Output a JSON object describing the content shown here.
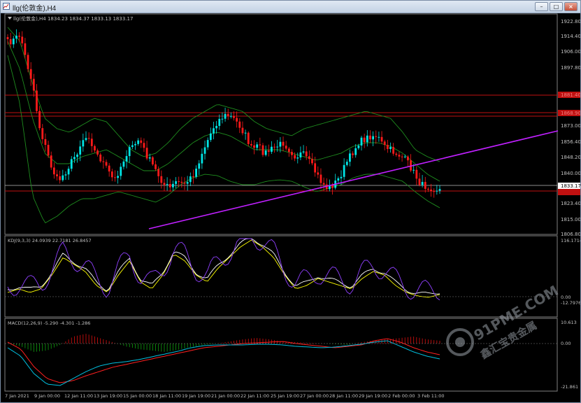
{
  "window": {
    "title": "llg(伦敦金),H4",
    "colors": {
      "titlebar": "#c3d2e4",
      "background": "#000000",
      "axis": "#c0c0c0"
    }
  },
  "main_chart": {
    "header_text": "llg(伦敦金),H4  1834.23 1834.37 1833.13 1833.17",
    "price_ticks": [
      "1922.80",
      "1914.40",
      "1906.00",
      "1897.80",
      "1873.00",
      "1856.40",
      "1848.20",
      "1840.00",
      "1823.40",
      "1815.00",
      "1806.80"
    ],
    "ghost_labels": [
      "1881.40",
      "1868.90"
    ],
    "current_price_label": "1833.17",
    "colors": {
      "bull_candle": "#00e5e5",
      "bear_candle": "#ff1a1a",
      "bollinger": "#1e8c1e",
      "trendline": "#c020ff",
      "hline": "#c01010",
      "price_line": "#bbbbbb"
    }
  },
  "kdj": {
    "header_text": "KDJ(9,3,3) 24.0939 22.7181 26.8457",
    "ticks": [
      "116.1714",
      "0.00",
      "-12.7976"
    ],
    "colors": {
      "K": "#ffffff",
      "D": "#ffff00",
      "J": "#9040ff"
    }
  },
  "macd": {
    "header_text": "MACD(12,26,9) -5.290 -4.301 -1.286",
    "ticks": [
      "10.613",
      "0.00",
      "-21.861"
    ],
    "colors": {
      "macd": "#00c0e0",
      "signal": "#ff2020",
      "hist_pos": "#10a010",
      "hist_neg": "#e01010"
    }
  },
  "time_axis": {
    "labels": [
      "7 Jan 2021",
      "9 Jan 00:00",
      "12 Jan 11:00",
      "13 Jan 19:00",
      "15 Jan 00:00",
      "18 Jan 11:00",
      "19 Jan 19:00",
      "21 Jan 00:00",
      "22 Jan 11:00",
      "25 Jan 19:00",
      "27 Jan 00:00",
      "28 Jan 11:00",
      "29 Jan 19:00",
      "2 Feb 00:00",
      "3 Feb 11:00"
    ]
  },
  "watermark": {
    "brand": "91PME.COM",
    "chinese": "鑫汇宝贵金属"
  }
}
